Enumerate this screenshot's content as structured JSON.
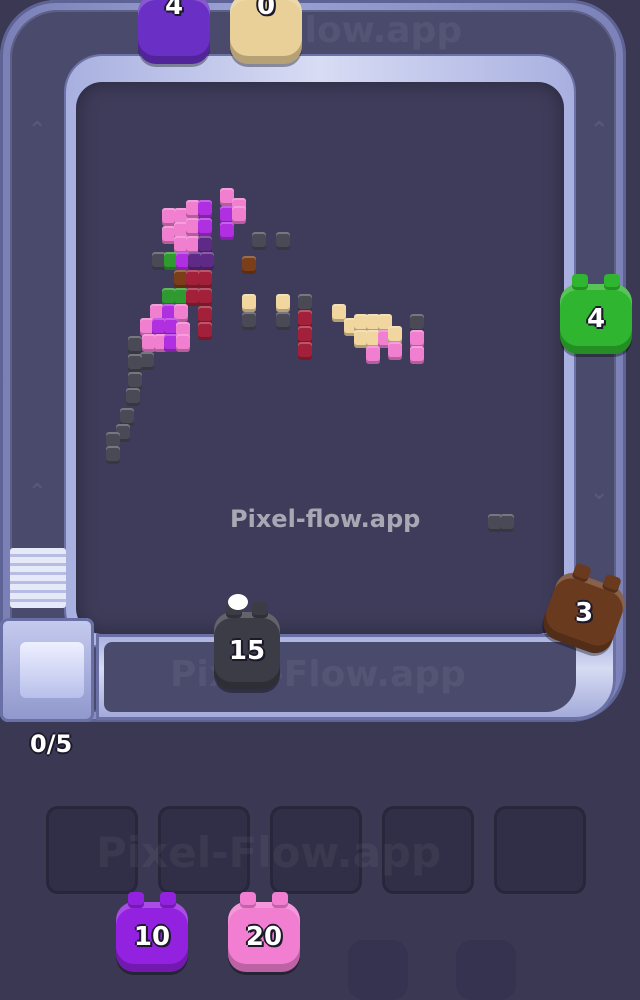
{
  "watermark": {
    "center_text": "Pixel-flow.app",
    "lane_text": "Pixel-Flow.app",
    "slots_text": "Pixel-Flow.app",
    "top_text": "Flow.app"
  },
  "counter": {
    "text": "0/5"
  },
  "colors": {
    "background": "#3a3852",
    "track": "#9aa3d6",
    "canvas": "#3e3c5a",
    "purple": "#8a1fd6",
    "tan": "#f1d6a0",
    "green": "#2fb52f",
    "brown": "#6a3a1e",
    "black": "#3a3a44",
    "pink": "#f07fd0"
  },
  "critters": [
    {
      "id": "top-purple",
      "label": "4",
      "color": "#6a2fc4",
      "icon": "purple-critter"
    },
    {
      "id": "top-tan",
      "label": "0",
      "color": "#e9cf98",
      "icon": "tan-critter"
    },
    {
      "id": "right-green",
      "label": "4",
      "color": "#2fb52f",
      "icon": "green-critter"
    },
    {
      "id": "right-brown",
      "label": "3",
      "color": "#6a3a1e",
      "icon": "brown-critter"
    },
    {
      "id": "bottom-black",
      "label": "15",
      "color": "#3c3c46",
      "icon": "black-critter"
    },
    {
      "id": "queue-purple",
      "label": "10",
      "color": "#9322e0",
      "icon": "purple-critter"
    },
    {
      "id": "queue-pink",
      "label": "20",
      "color": "#f27ed2",
      "icon": "pink-critter"
    }
  ],
  "slots": {
    "count": 5,
    "filled": 0
  },
  "pixel_art": {
    "palette": {
      "P": "#b02fe0",
      "K": "#f07fd0",
      "R": "#a3203a",
      "G": "#2f9a2f",
      "B": "#4a4a56",
      "T": "#f1d6a0",
      "N": "#7a3e18",
      "D": "#5e2a86"
    }
  }
}
